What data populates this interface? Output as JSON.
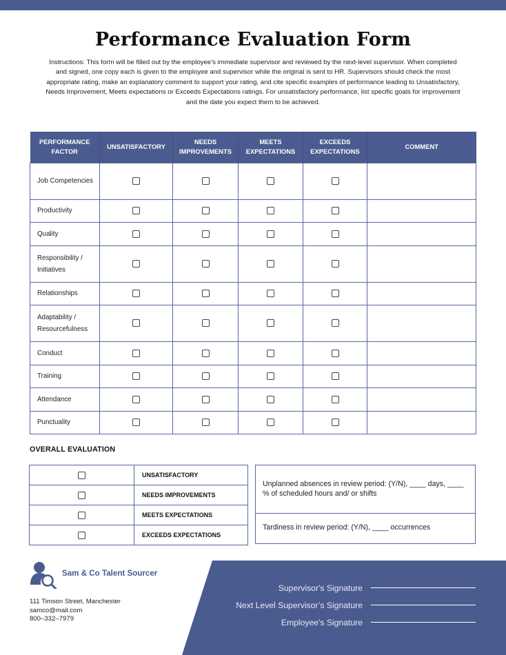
{
  "document": {
    "title": "Performance Evaluation Form",
    "instructions": "Instructions: This form will be filled out by the employee's immediate supervisor and reviewed by the next-level supervisor. When completed and signed, one copy each is given to the employee and supervisor while the original is sent to HR.  Supervisors should check the most appropriate rating, make an explanatory comment to support your rating, and cite specific examples of performance leading to Unsatisfactory,  Needs Improvement, Meets expectations or Exceeds Expectations ratings. For unsatisfactory performance, list specific goals for improvement and the date you expect them to be achieved."
  },
  "colors": {
    "accent": "#4a5b8f",
    "border": "#5467a0",
    "header_text": "#ffffff"
  },
  "table": {
    "headers": [
      "PERFORMANCE FACTOR",
      "UNSATISFACTORY",
      "NEEDS IMPROVEMENTS",
      "MEETS EXPECTATIONS",
      "EXCEEDS EXPECTATIONS",
      "COMMENT"
    ],
    "rows": [
      {
        "factor": "Job Competencies",
        "checked": [
          false,
          false,
          false,
          false
        ],
        "comment": ""
      },
      {
        "factor": "Productivity",
        "checked": [
          false,
          false,
          false,
          false
        ],
        "comment": ""
      },
      {
        "factor": "Quality",
        "checked": [
          false,
          false,
          false,
          false
        ],
        "comment": ""
      },
      {
        "factor": "Responsibility / Initiatives",
        "checked": [
          false,
          false,
          false,
          false
        ],
        "comment": ""
      },
      {
        "factor": "Relationships",
        "checked": [
          false,
          false,
          false,
          false
        ],
        "comment": ""
      },
      {
        "factor": "Adaptability / Resourcefulness",
        "checked": [
          false,
          false,
          false,
          false
        ],
        "comment": ""
      },
      {
        "factor": "Conduct",
        "checked": [
          false,
          false,
          false,
          false
        ],
        "comment": ""
      },
      {
        "factor": "Training",
        "checked": [
          false,
          false,
          false,
          false
        ],
        "comment": ""
      },
      {
        "factor": "Attendance",
        "checked": [
          false,
          false,
          false,
          false
        ],
        "comment": ""
      },
      {
        "factor": "Punctuality",
        "checked": [
          false,
          false,
          false,
          false
        ],
        "comment": ""
      }
    ]
  },
  "overall": {
    "label": "OVERALL EVALUATION",
    "options": [
      {
        "label": "UNSATISFACTORY",
        "checked": false
      },
      {
        "label": "NEEDS IMPROVEMENTS",
        "checked": false
      },
      {
        "label": "MEETS EXPECTATIONS",
        "checked": false
      },
      {
        "label": "EXCEEDS EXPECTATIONS",
        "checked": false
      }
    ],
    "absences_text": "Unplanned absences in review period: (Y/N), ____ days, ____ % of scheduled hours and/ or shifts",
    "tardiness_text": "Tardiness in review period: (Y/N), ____ occurrences"
  },
  "company": {
    "name": "Sam & Co Talent Sourcer",
    "logo_icon": "user-search-icon",
    "address": "111 Timson Street, Manchester",
    "email": "samco@mail.com",
    "phone": "800–332–7979"
  },
  "signatures": [
    {
      "label": "Supervisor's Signature"
    },
    {
      "label": "Next Level Supervisor’s Signature"
    },
    {
      "label": "Employee's Signature"
    }
  ]
}
